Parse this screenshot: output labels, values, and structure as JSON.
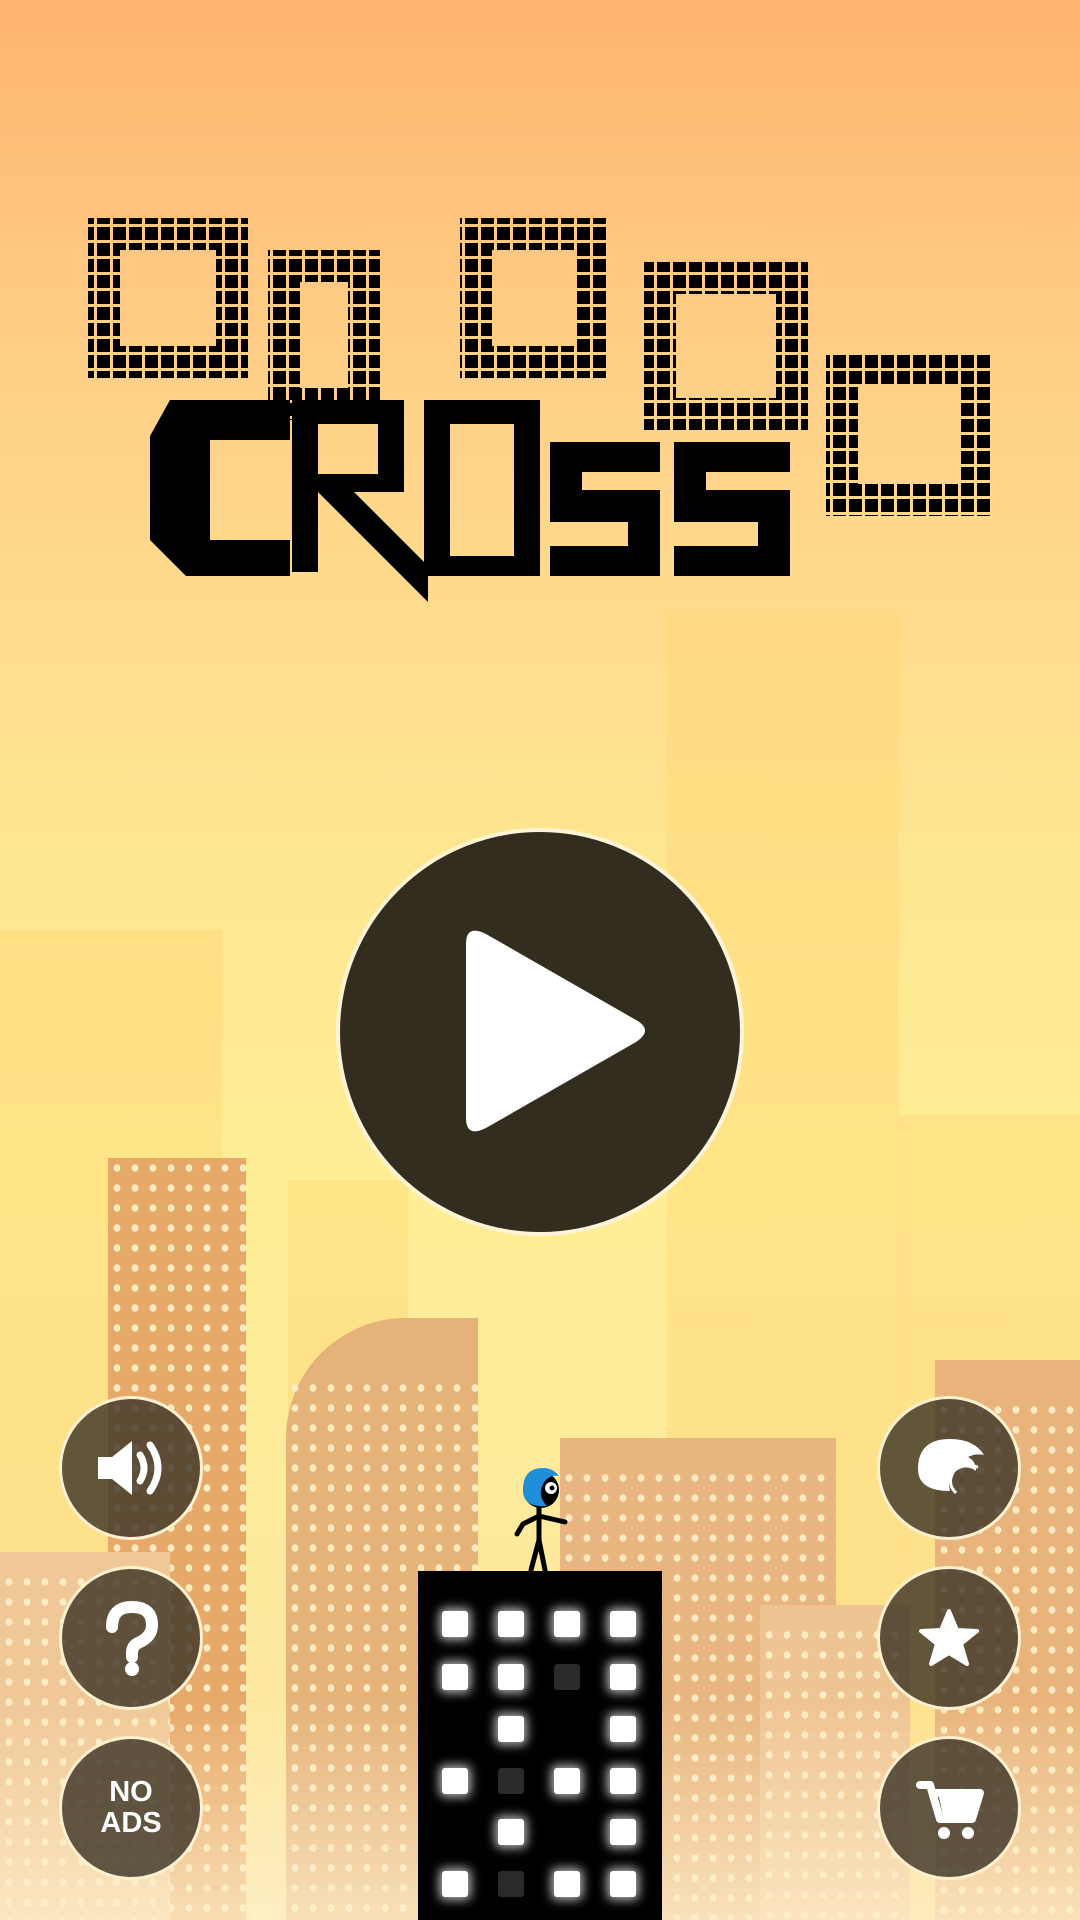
{
  "game": {
    "title_line1": "Urban",
    "title_line2": "CROss",
    "no_ads_line1": "NO",
    "no_ads_line2": "ADS"
  },
  "buttons": {
    "play": "play-icon",
    "sound": "speaker-icon",
    "help": "question-icon",
    "no_ads": "no-ads",
    "helmet": "helmet-icon",
    "rate": "star-icon",
    "shop": "cart-icon"
  },
  "colors": {
    "sky_top": "#ffb56f",
    "sky_bottom": "#fde7a3",
    "button_dark": "#332d1f",
    "title": "#000000",
    "helmet": "#1e8fd8"
  }
}
